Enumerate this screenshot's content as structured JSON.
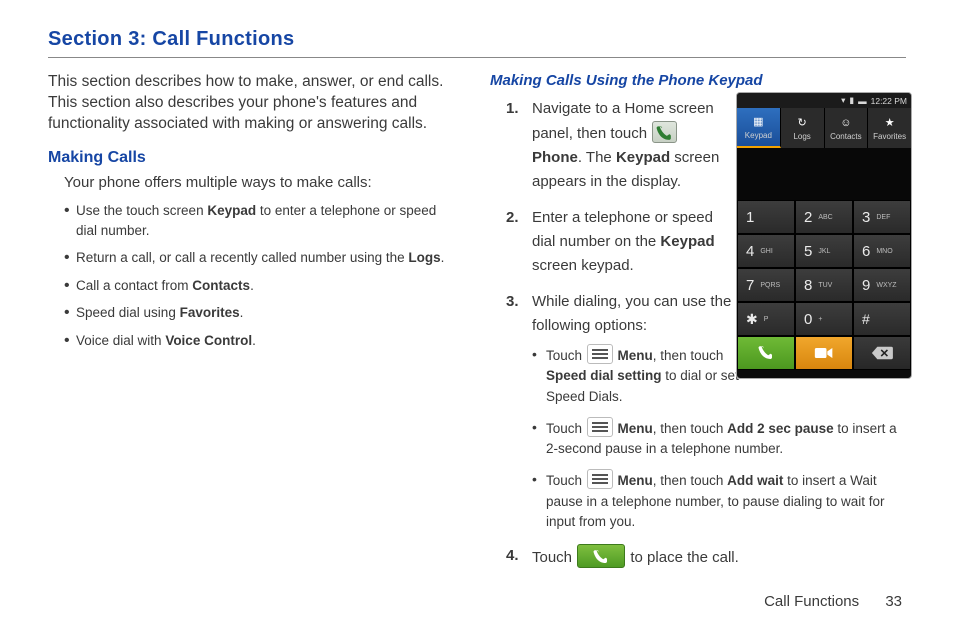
{
  "section_title": "Section 3: Call Functions",
  "intro": "This section describes how to make, answer, or end calls. This section also describes your phone's features and functionality associated with making or answering calls.",
  "h_making_calls": "Making Calls",
  "making_calls_lead": "Your phone offers multiple ways to make calls:",
  "bullets": {
    "b1a": "Use the touch screen ",
    "b1b": "Keypad",
    "b1c": " to enter a telephone or speed dial number.",
    "b2a": "Return a call, or call a recently called number using the ",
    "b2b": "Logs",
    "b2c": ".",
    "b3a": "Call a contact from ",
    "b3b": "Contacts",
    "b3c": ".",
    "b4a": "Speed dial using ",
    "b4b": "Favorites",
    "b4c": ".",
    "b5a": "Voice dial with ",
    "b5b": "Voice Control",
    "b5c": "."
  },
  "h_keypad": "Making Calls Using the Phone Keypad",
  "steps": {
    "n1": "1.",
    "s1a": "Navigate to a Home screen panel, then touch ",
    "s1_phone": "Phone",
    "s1b": ". The ",
    "s1_keypad": "Keypad",
    "s1c": " screen appears in the display.",
    "n2": "2.",
    "s2a": "Enter a telephone or speed dial number on the ",
    "s2_keypad": "Keypad",
    "s2b": " screen keypad.",
    "n3": "3.",
    "s3": "While dialing, you can use the following options:",
    "sub1a": "Touch ",
    "sub_menu": "Menu",
    "sub1b": ", then touch ",
    "sub1_sds": "Speed dial setting",
    "sub1c": " to dial or set Speed Dials.",
    "sub2b": ", then touch ",
    "sub2_add": "Add 2 sec pause",
    "sub2c": " to insert a 2-second pause in a telephone number.",
    "sub3b": ", then touch ",
    "sub3_addwait": "Add wait",
    "sub3c": " to insert a Wait pause in a telephone number, to pause dialing to wait for input from you.",
    "n4": "4.",
    "s4a": "Touch ",
    "s4b": " to place the call."
  },
  "phone": {
    "time": "12:22 PM",
    "tabs": {
      "keypad": "Keypad",
      "logs": "Logs",
      "contacts": "Contacts",
      "favorites": "Favorites"
    },
    "keys": {
      "k1d": "1",
      "k1l": "",
      "k2d": "2",
      "k2l": "ABC",
      "k3d": "3",
      "k3l": "DEF",
      "k4d": "4",
      "k4l": "GHI",
      "k5d": "5",
      "k5l": "JKL",
      "k6d": "6",
      "k6l": "MNO",
      "k7d": "7",
      "k7l": "PQRS",
      "k8d": "8",
      "k8l": "TUV",
      "k9d": "9",
      "k9l": "WXYZ",
      "kstar": "✱",
      "kstarl": "P",
      "k0d": "0",
      "k0l": "+",
      "khash": "#",
      "khashl": ""
    }
  },
  "footer": {
    "label": "Call Functions",
    "page": "33"
  }
}
